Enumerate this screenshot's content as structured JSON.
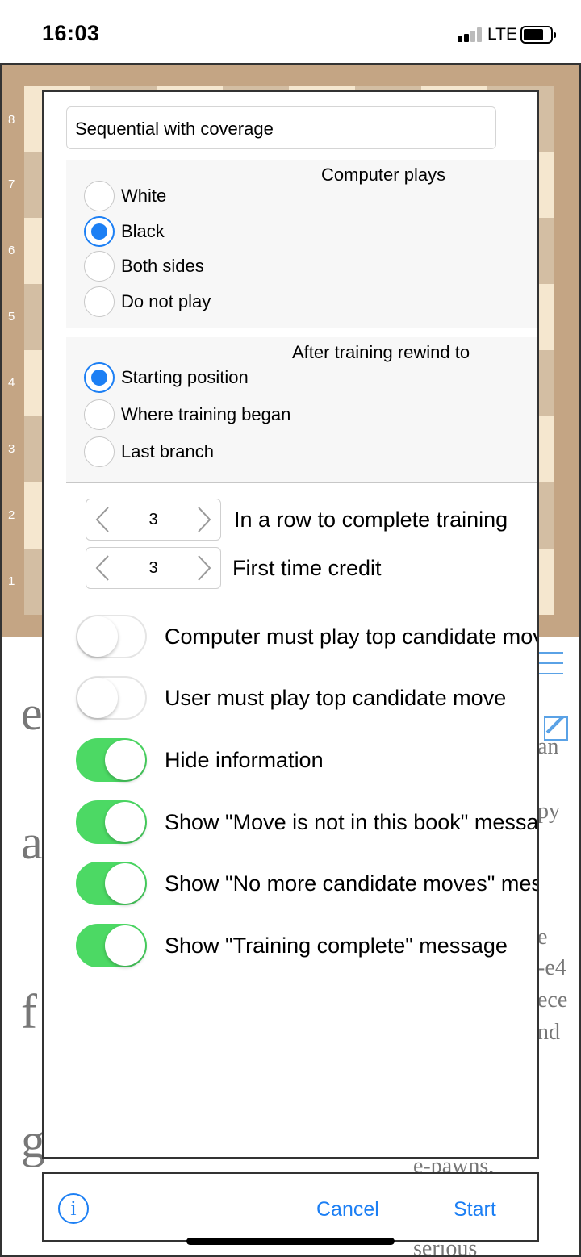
{
  "status_bar": {
    "time": "16:03",
    "network": "LTE"
  },
  "board": {
    "ranks": [
      "8",
      "7",
      "6",
      "5",
      "4",
      "3",
      "2",
      "1"
    ]
  },
  "background_text": {
    "letters": [
      "e",
      "a",
      "f",
      "g"
    ],
    "right_fragments": [
      "an",
      "py",
      "e",
      "-e4",
      "ece",
      "nd",
      "e-pawns,",
      "serious"
    ]
  },
  "modal": {
    "mode_value": "Sequential with coverage",
    "computer_plays": {
      "title": "Computer plays",
      "options": [
        "White",
        "Black",
        "Both sides",
        "Do not play"
      ],
      "selected": "Black"
    },
    "rewind": {
      "title": "After training rewind to",
      "options": [
        "Starting position",
        "Where training began",
        "Last branch"
      ],
      "selected": "Starting position"
    },
    "steppers": [
      {
        "value": "3",
        "label": "In a row to complete training"
      },
      {
        "value": "3",
        "label": "First time credit"
      }
    ],
    "toggles": [
      {
        "label": "Computer must play top candidate move",
        "on": false
      },
      {
        "label": "User must play top candidate move",
        "on": false
      },
      {
        "label": "Hide information",
        "on": true
      },
      {
        "label": "Show \"Move is not in this book\" message",
        "on": true
      },
      {
        "label": "Show \"No more candidate moves\" message",
        "on": true
      },
      {
        "label": "Show \"Training complete\" message",
        "on": true
      }
    ]
  },
  "toolbar": {
    "info_icon": "i",
    "cancel_label": "Cancel",
    "start_label": "Start"
  },
  "colors": {
    "accent": "#1c7ff4",
    "toggle_on": "#4cd964"
  }
}
